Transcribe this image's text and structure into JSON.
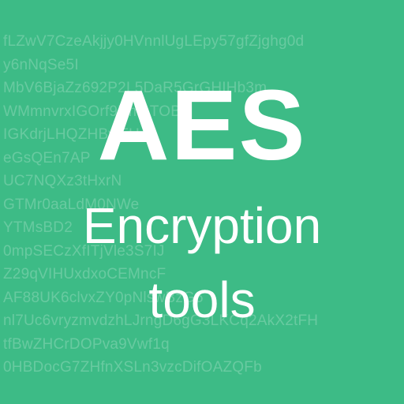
{
  "colors": {
    "background": "#3dbb86",
    "foreground": "#ffffff"
  },
  "background_text": [
    "fLZwV7CzeAkjjy0HVnnlUgLEpy57gfZjghg0d",
    "y6nNqSe5I",
    "MbV6BjaZz692P2L5DaR5GrGHIHb3m",
    "WMmnvrxIGOrf9UmaTOBj",
    "IGKdrjLHQZHBwFH",
    "eGsQEn7AP",
    "UC7NQXz3tHxrN",
    "GTMr0aaLdM0NWe",
    "YTMsBD2",
    "0mpSECzXfITjVle3S7IJ",
    "Z29qVIHUxdxoCEMncF",
    "AF88UK6clvxZY0pNlswBzG6",
    "nl7Uc6vryzmvdzhLJrngD6gG3LKCq2AkX2tFH",
    "tfBwZHCrDOPva9Vwf1q",
    "0HBDocG7ZHfnXSLn3vzcDifOAZQFb"
  ],
  "title": {
    "main": "AES",
    "line1": "Encryption",
    "line2": "tools"
  }
}
